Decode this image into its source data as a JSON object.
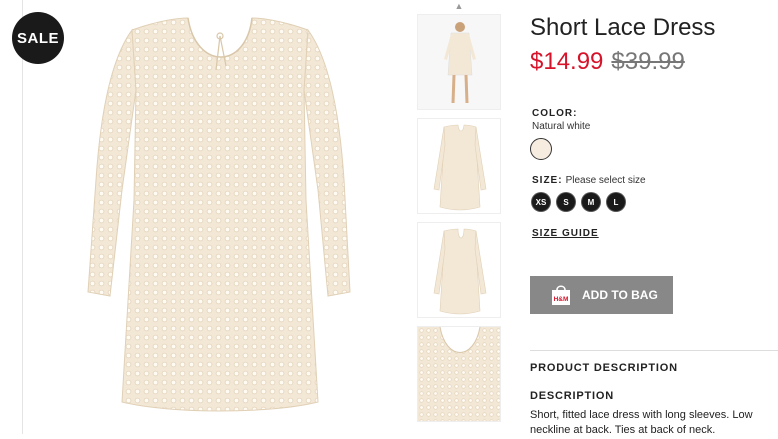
{
  "badge": {
    "label": "SALE"
  },
  "product": {
    "title": "Short Lace Dress",
    "price_sale": "$14.99",
    "price_original": "$39.99"
  },
  "color": {
    "label": "COLOR:",
    "value": "Natural white",
    "swatch_hex": "#f6ece0"
  },
  "size": {
    "label": "SIZE:",
    "hint": "Please select size",
    "options": [
      "XS",
      "S",
      "M",
      "L"
    ]
  },
  "links": {
    "size_guide": "SIZE GUIDE"
  },
  "cart": {
    "add_label": "ADD TO BAG",
    "bag_brand": "H&M"
  },
  "description": {
    "section_title": "PRODUCT DESCRIPTION",
    "heading": "DESCRIPTION",
    "text": "Short, fitted lace dress with long sleeves. Low neckline at back. Ties at back of neck."
  },
  "colors": {
    "sale_price": "#d6132a",
    "badge_bg": "#1a1a1a",
    "button_bg": "#888888",
    "dress": "#f3e8d6"
  }
}
